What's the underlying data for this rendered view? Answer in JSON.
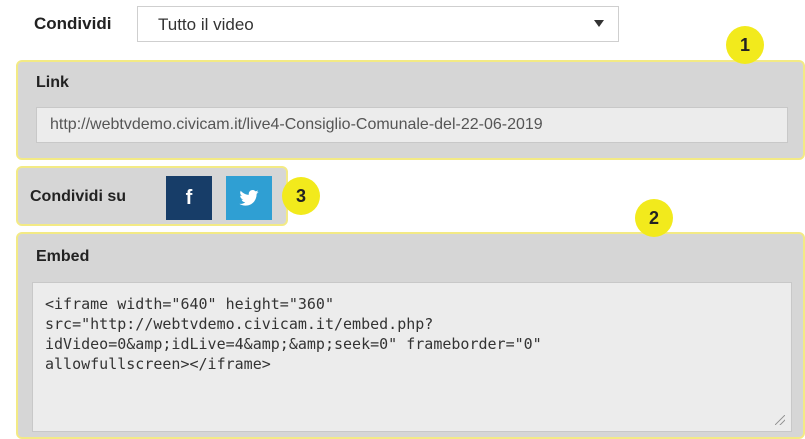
{
  "share": {
    "label": "Condividi",
    "select_value": "Tutto il video"
  },
  "link_panel": {
    "title": "Link",
    "url": "http://webtvdemo.civicam.it/live4-Consiglio-Comunale-del-22-06-2019"
  },
  "social": {
    "label": "Condividi su",
    "facebook_glyph": "f",
    "facebook_color": "#173d68",
    "twitter_color": "#2f9fd3",
    "icons": [
      "facebook-icon",
      "twitter-icon"
    ]
  },
  "embed_panel": {
    "title": "Embed",
    "code": "<iframe width=\"640\" height=\"360\"\nsrc=\"http://webtvdemo.civicam.it/embed.php?\nidVideo=0&amp;idLive=4&amp;&amp;seek=0\" frameborder=\"0\"\nallowfullscreen></iframe>"
  },
  "badges": [
    "1",
    "2",
    "3"
  ],
  "colors": {
    "panel_bg": "#d6d6d6",
    "panel_border": "#f3ea85",
    "badge": "#f2ea1c"
  }
}
